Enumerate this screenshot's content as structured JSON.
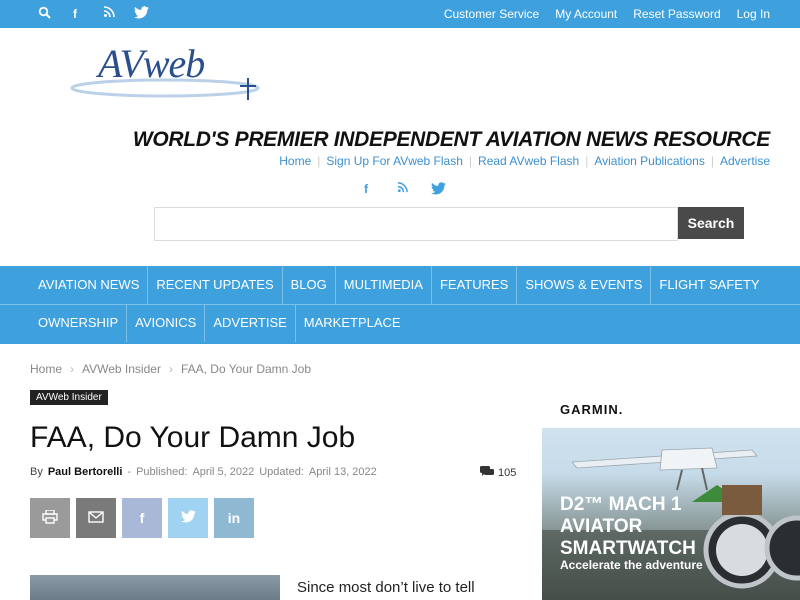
{
  "topbar": {
    "icons": [
      "search-icon",
      "facebook-icon",
      "rss-icon",
      "twitter-icon"
    ],
    "links": [
      "Customer Service",
      "My Account",
      "Reset Password",
      "Log In"
    ],
    "color": "#3ea0dc"
  },
  "logo": {
    "text": "AVweb"
  },
  "tagline": "WORLD'S PREMIER INDEPENDENT AVIATION NEWS RESOURCE",
  "sublinks": [
    "Home",
    "Sign Up For AVweb Flash",
    "Read AVweb Flash",
    "Aviation Publications",
    "Advertise"
  ],
  "search": {
    "placeholder": "",
    "button": "Search"
  },
  "nav": {
    "row1": [
      "AVIATION NEWS",
      "RECENT UPDATES",
      "BLOG",
      "MULTIMEDIA",
      "FEATURES",
      "SHOWS & EVENTS",
      "FLIGHT SAFETY"
    ],
    "row2": [
      "OWNERSHIP",
      "AVIONICS",
      "ADVERTISE",
      "MARKETPLACE"
    ]
  },
  "breadcrumbs": [
    "Home",
    "AVWeb Insider",
    "FAA, Do Your Damn Job"
  ],
  "article": {
    "category": "AVWeb Insider",
    "title": "FAA, Do Your Damn Job",
    "by": "By",
    "author": "Paul Bertorelli",
    "dash": "-",
    "published_label": "Published:",
    "published": "April 5, 2022",
    "updated_label": "Updated:",
    "updated": "April 13, 2022",
    "comments": "105",
    "body_start": "Since most don’t live to tell"
  },
  "share": [
    {
      "name": "print-icon",
      "color": "#9a9a9a"
    },
    {
      "name": "email-icon",
      "color": "#7a7a7a"
    },
    {
      "name": "facebook-icon",
      "color": "#aab8d8"
    },
    {
      "name": "twitter-icon",
      "color": "#9fd3f1"
    },
    {
      "name": "linkedin-icon",
      "color": "#8fb9d3"
    }
  ],
  "ad": {
    "brand": "GARMIN.",
    "headline": "D2™ MACH 1 AVIATOR SMARTWATCH",
    "sub": "Accelerate the adventure"
  }
}
